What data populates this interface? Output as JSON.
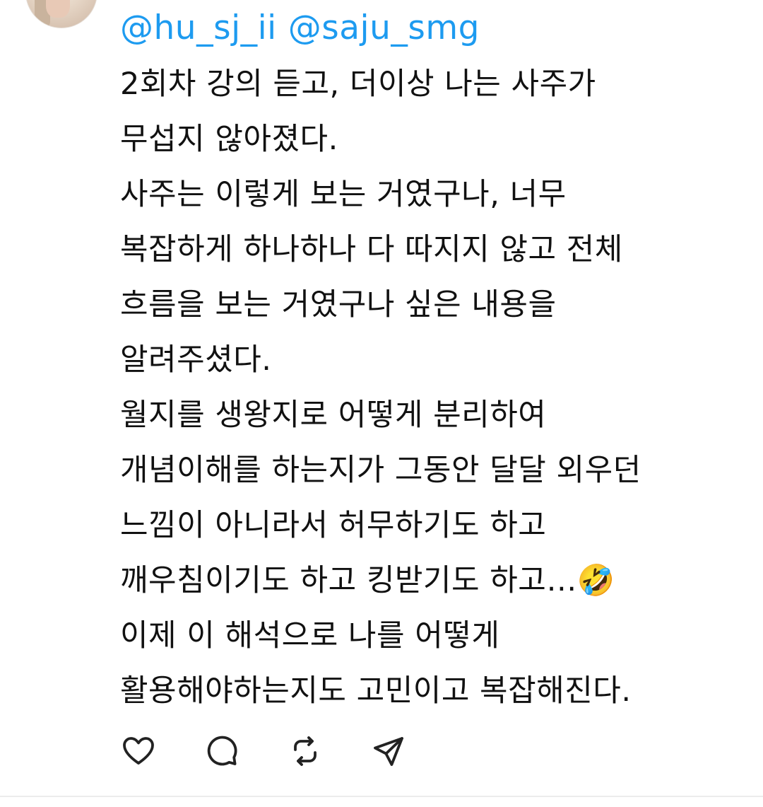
{
  "post": {
    "mentions": [
      "@hu_sj_ii",
      "@saju_smg"
    ],
    "lines": [
      "2회차 강의 듣고, 더이상 나는 사주가",
      "무섭지 않아졌다.",
      "사주는 이렇게 보는 거였구나, 너무",
      "복잡하게 하나하나 다 따지지 않고 전체",
      "흐름을 보는 거였구나 싶은 내용을",
      "알려주셨다.",
      "월지를 생왕지로 어떻게 분리하여",
      "개념이해를 하는지가 그동안 달달 외우던",
      "느낌이 아니라서 허무하기도 하고",
      "깨우침이기도 하고 킹받기도 하고…🤣",
      "이제 이 해석으로 나를 어떻게",
      "활용해야하는지도 고민이고 복잡해진다."
    ]
  },
  "actions": [
    {
      "name": "like-button",
      "icon": "heart-icon"
    },
    {
      "name": "reply-button",
      "icon": "speech-bubble-icon"
    },
    {
      "name": "repost-button",
      "icon": "repost-icon"
    },
    {
      "name": "share-button",
      "icon": "send-icon"
    }
  ],
  "colors": {
    "mention": "#1d9bf0",
    "text": "#111111",
    "icon": "#222222"
  }
}
